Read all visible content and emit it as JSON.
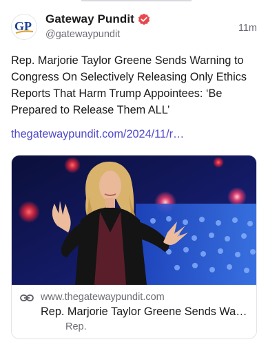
{
  "post": {
    "account_name": "Gateway Pundit",
    "avatar_initials": "GP",
    "handle": "@gatewaypundit",
    "time": "11m",
    "text": "Rep. Marjorie Taylor Greene Sends Warning to Congress On Selectively Releasing Only Ethics Reports That Harm Trump Appointees: ‘Be Prepared to Release Them ALL’",
    "link": "thegatewaypundit.com/2024/11/r…"
  },
  "card": {
    "domain": "www.thegatewaypundit.com",
    "title": "Rep. Marjorie Taylor Greene Sends Wa…",
    "description": "Rep."
  },
  "colors": {
    "accent_link": "#4f49c9",
    "verified_badge": "#e5484d",
    "avatar_blue": "#1c3f94",
    "avatar_gold": "#e0a32a",
    "muted_text": "#6b6b74"
  },
  "icons": {
    "verified": "verified-badge-icon",
    "link": "link-icon",
    "avatar": "gateway-pundit-logo"
  }
}
